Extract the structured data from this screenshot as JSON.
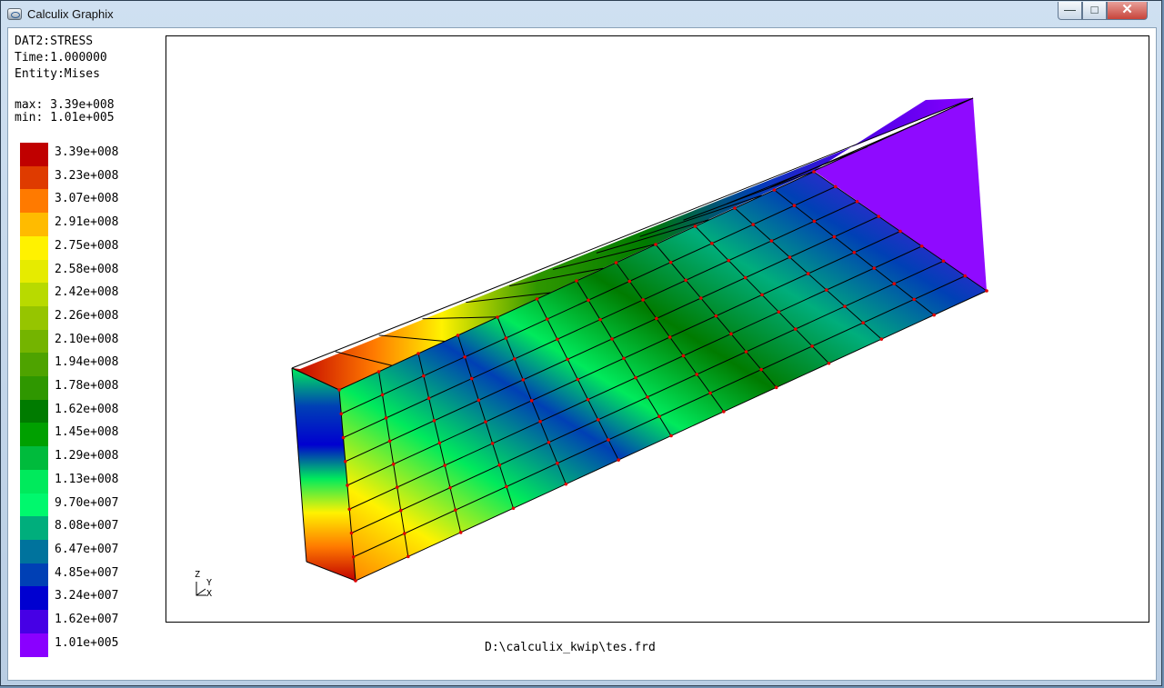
{
  "window": {
    "title": "Calculix Graphix",
    "controls": [
      "—",
      "□",
      "✕"
    ]
  },
  "info": {
    "dataset": "DAT2:STRESS",
    "time": "Time:1.000000",
    "entity": "Entity:Mises",
    "max": "max: 3.39e+008",
    "min": "min: 1.01e+005"
  },
  "legend": [
    {
      "label": "3.39e+008",
      "color": "#c00000"
    },
    {
      "label": "3.23e+008",
      "color": "#df3b00"
    },
    {
      "label": "3.07e+008",
      "color": "#ff7a00"
    },
    {
      "label": "2.91e+008",
      "color": "#ffbb00"
    },
    {
      "label": "2.75e+008",
      "color": "#fff200"
    },
    {
      "label": "2.58e+008",
      "color": "#e6eb00"
    },
    {
      "label": "2.42e+008",
      "color": "#b8da00"
    },
    {
      "label": "2.26e+008",
      "color": "#96c500"
    },
    {
      "label": "2.10e+008",
      "color": "#74b400"
    },
    {
      "label": "1.94e+008",
      "color": "#4ea300"
    },
    {
      "label": "1.78e+008",
      "color": "#2f9700"
    },
    {
      "label": "1.62e+008",
      "color": "#007b00"
    },
    {
      "label": "1.45e+008",
      "color": "#00a000"
    },
    {
      "label": "1.29e+008",
      "color": "#00bb3c"
    },
    {
      "label": "1.13e+008",
      "color": "#00ea5c"
    },
    {
      "label": "9.70e+007",
      "color": "#00f86d"
    },
    {
      "label": "8.08e+007",
      "color": "#00ae7c"
    },
    {
      "label": "6.47e+007",
      "color": "#00739d"
    },
    {
      "label": "4.85e+007",
      "color": "#0040b5"
    },
    {
      "label": "3.24e+007",
      "color": "#0000d0"
    },
    {
      "label": "1.62e+007",
      "color": "#4600e5"
    },
    {
      "label": "1.01e+005",
      "color": "#8a00ff"
    }
  ],
  "axes": {
    "z": "Z",
    "y": "Y",
    "x": "X"
  },
  "filename": "D:\\calculix_kwip\\tes.frd",
  "mesh_color": "#000000",
  "node_color": "#e00000"
}
